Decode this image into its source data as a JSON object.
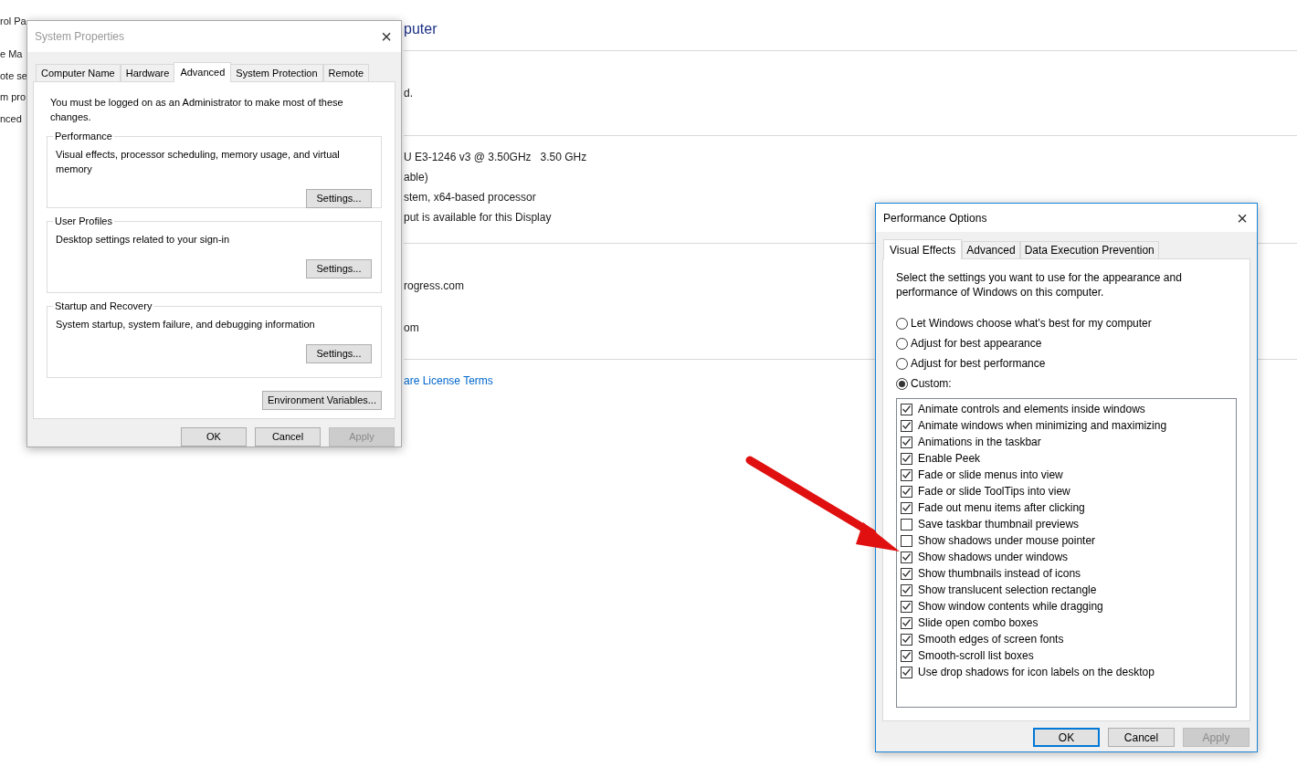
{
  "control_panel": {
    "sidebar_items": [
      "rol Pa",
      "e Ma",
      "ote se",
      "m pro",
      "nced"
    ],
    "heading": "puter",
    "sections": [
      [
        {
          "kind": "text",
          "text": "d."
        }
      ],
      [
        {
          "kind": "text",
          "text": "U E3-1246 v3 @ 3.50GHz   3.50 GHz"
        },
        {
          "kind": "text",
          "text": "able)"
        },
        {
          "kind": "text",
          "text": "stem, x64-based processor"
        },
        {
          "kind": "text",
          "text": "put is available for this Display"
        }
      ],
      [
        {
          "kind": "text",
          "text": "rogress.com"
        },
        {
          "kind": "gap"
        },
        {
          "kind": "text",
          "text": "om"
        }
      ],
      [
        {
          "kind": "link",
          "text": "are License Terms"
        }
      ]
    ]
  },
  "system_properties": {
    "title": "System Properties",
    "close": "×",
    "tabs": [
      {
        "label": "Computer Name",
        "selected": false
      },
      {
        "label": "Hardware",
        "selected": false
      },
      {
        "label": "Advanced",
        "selected": true
      },
      {
        "label": "System Protection",
        "selected": false
      },
      {
        "label": "Remote",
        "selected": false
      }
    ],
    "notice": "You must be logged on as an Administrator to make most of these changes.",
    "groups": [
      {
        "title": "Performance",
        "description": "Visual effects, processor scheduling, memory usage, and virtual memory",
        "button": "Settings..."
      },
      {
        "title": "User Profiles",
        "description": "Desktop settings related to your sign-in",
        "button": "Settings..."
      },
      {
        "title": "Startup and Recovery",
        "description": "System startup, system failure, and debugging information",
        "button": "Settings..."
      }
    ],
    "extra_button": "Environment Variables...",
    "buttons": [
      {
        "label": "OK",
        "disabled": false,
        "default": false
      },
      {
        "label": "Cancel",
        "disabled": false,
        "default": false
      },
      {
        "label": "Apply",
        "disabled": true,
        "default": false
      }
    ]
  },
  "performance_options": {
    "title": "Performance Options",
    "close": "×",
    "tabs": [
      {
        "label": "Visual Effects",
        "selected": true
      },
      {
        "label": "Advanced",
        "selected": false
      },
      {
        "label": "Data Execution Prevention",
        "selected": false
      }
    ],
    "intro": "Select the settings you want to use for the appearance and performance of Windows on this computer.",
    "options": [
      {
        "label": "Let Windows choose what's best for my computer",
        "selected": false
      },
      {
        "label": "Adjust for best appearance",
        "selected": false
      },
      {
        "label": "Adjust for best performance",
        "selected": false
      },
      {
        "label": "Custom:",
        "selected": true
      }
    ],
    "effects": [
      {
        "label": "Animate controls and elements inside windows",
        "checked": true
      },
      {
        "label": "Animate windows when minimizing and maximizing",
        "checked": true
      },
      {
        "label": "Animations in the taskbar",
        "checked": true
      },
      {
        "label": "Enable Peek",
        "checked": true
      },
      {
        "label": "Fade or slide menus into view",
        "checked": true
      },
      {
        "label": "Fade or slide ToolTips into view",
        "checked": true
      },
      {
        "label": "Fade out menu items after clicking",
        "checked": true
      },
      {
        "label": "Save taskbar thumbnail previews",
        "checked": false
      },
      {
        "label": "Show shadows under mouse pointer",
        "checked": false
      },
      {
        "label": "Show shadows under windows",
        "checked": true
      },
      {
        "label": "Show thumbnails instead of icons",
        "checked": true
      },
      {
        "label": "Show translucent selection rectangle",
        "checked": true
      },
      {
        "label": "Show window contents while dragging",
        "checked": true
      },
      {
        "label": "Slide open combo boxes",
        "checked": true
      },
      {
        "label": "Smooth edges of screen fonts",
        "checked": true
      },
      {
        "label": "Smooth-scroll list boxes",
        "checked": true
      },
      {
        "label": "Use drop shadows for icon labels on the desktop",
        "checked": true
      }
    ],
    "buttons": [
      {
        "label": "OK",
        "disabled": false,
        "default": true
      },
      {
        "label": "Cancel",
        "disabled": false,
        "default": false
      },
      {
        "label": "Apply",
        "disabled": true,
        "default": false
      }
    ]
  }
}
